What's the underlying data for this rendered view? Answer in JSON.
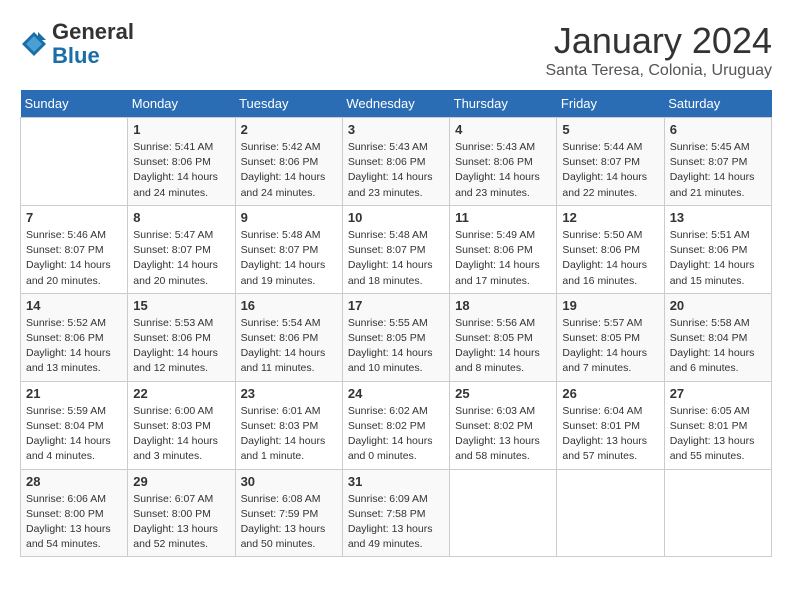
{
  "logo": {
    "general": "General",
    "blue": "Blue"
  },
  "header": {
    "month": "January 2024",
    "location": "Santa Teresa, Colonia, Uruguay"
  },
  "weekdays": [
    "Sunday",
    "Monday",
    "Tuesday",
    "Wednesday",
    "Thursday",
    "Friday",
    "Saturday"
  ],
  "weeks": [
    [
      {
        "day": "",
        "info": ""
      },
      {
        "day": "1",
        "info": "Sunrise: 5:41 AM\nSunset: 8:06 PM\nDaylight: 14 hours\nand 24 minutes."
      },
      {
        "day": "2",
        "info": "Sunrise: 5:42 AM\nSunset: 8:06 PM\nDaylight: 14 hours\nand 24 minutes."
      },
      {
        "day": "3",
        "info": "Sunrise: 5:43 AM\nSunset: 8:06 PM\nDaylight: 14 hours\nand 23 minutes."
      },
      {
        "day": "4",
        "info": "Sunrise: 5:43 AM\nSunset: 8:06 PM\nDaylight: 14 hours\nand 23 minutes."
      },
      {
        "day": "5",
        "info": "Sunrise: 5:44 AM\nSunset: 8:07 PM\nDaylight: 14 hours\nand 22 minutes."
      },
      {
        "day": "6",
        "info": "Sunrise: 5:45 AM\nSunset: 8:07 PM\nDaylight: 14 hours\nand 21 minutes."
      }
    ],
    [
      {
        "day": "7",
        "info": "Sunrise: 5:46 AM\nSunset: 8:07 PM\nDaylight: 14 hours\nand 20 minutes."
      },
      {
        "day": "8",
        "info": "Sunrise: 5:47 AM\nSunset: 8:07 PM\nDaylight: 14 hours\nand 20 minutes."
      },
      {
        "day": "9",
        "info": "Sunrise: 5:48 AM\nSunset: 8:07 PM\nDaylight: 14 hours\nand 19 minutes."
      },
      {
        "day": "10",
        "info": "Sunrise: 5:48 AM\nSunset: 8:07 PM\nDaylight: 14 hours\nand 18 minutes."
      },
      {
        "day": "11",
        "info": "Sunrise: 5:49 AM\nSunset: 8:06 PM\nDaylight: 14 hours\nand 17 minutes."
      },
      {
        "day": "12",
        "info": "Sunrise: 5:50 AM\nSunset: 8:06 PM\nDaylight: 14 hours\nand 16 minutes."
      },
      {
        "day": "13",
        "info": "Sunrise: 5:51 AM\nSunset: 8:06 PM\nDaylight: 14 hours\nand 15 minutes."
      }
    ],
    [
      {
        "day": "14",
        "info": "Sunrise: 5:52 AM\nSunset: 8:06 PM\nDaylight: 14 hours\nand 13 minutes."
      },
      {
        "day": "15",
        "info": "Sunrise: 5:53 AM\nSunset: 8:06 PM\nDaylight: 14 hours\nand 12 minutes."
      },
      {
        "day": "16",
        "info": "Sunrise: 5:54 AM\nSunset: 8:06 PM\nDaylight: 14 hours\nand 11 minutes."
      },
      {
        "day": "17",
        "info": "Sunrise: 5:55 AM\nSunset: 8:05 PM\nDaylight: 14 hours\nand 10 minutes."
      },
      {
        "day": "18",
        "info": "Sunrise: 5:56 AM\nSunset: 8:05 PM\nDaylight: 14 hours\nand 8 minutes."
      },
      {
        "day": "19",
        "info": "Sunrise: 5:57 AM\nSunset: 8:05 PM\nDaylight: 14 hours\nand 7 minutes."
      },
      {
        "day": "20",
        "info": "Sunrise: 5:58 AM\nSunset: 8:04 PM\nDaylight: 14 hours\nand 6 minutes."
      }
    ],
    [
      {
        "day": "21",
        "info": "Sunrise: 5:59 AM\nSunset: 8:04 PM\nDaylight: 14 hours\nand 4 minutes."
      },
      {
        "day": "22",
        "info": "Sunrise: 6:00 AM\nSunset: 8:03 PM\nDaylight: 14 hours\nand 3 minutes."
      },
      {
        "day": "23",
        "info": "Sunrise: 6:01 AM\nSunset: 8:03 PM\nDaylight: 14 hours\nand 1 minute."
      },
      {
        "day": "24",
        "info": "Sunrise: 6:02 AM\nSunset: 8:02 PM\nDaylight: 14 hours\nand 0 minutes."
      },
      {
        "day": "25",
        "info": "Sunrise: 6:03 AM\nSunset: 8:02 PM\nDaylight: 13 hours\nand 58 minutes."
      },
      {
        "day": "26",
        "info": "Sunrise: 6:04 AM\nSunset: 8:01 PM\nDaylight: 13 hours\nand 57 minutes."
      },
      {
        "day": "27",
        "info": "Sunrise: 6:05 AM\nSunset: 8:01 PM\nDaylight: 13 hours\nand 55 minutes."
      }
    ],
    [
      {
        "day": "28",
        "info": "Sunrise: 6:06 AM\nSunset: 8:00 PM\nDaylight: 13 hours\nand 54 minutes."
      },
      {
        "day": "29",
        "info": "Sunrise: 6:07 AM\nSunset: 8:00 PM\nDaylight: 13 hours\nand 52 minutes."
      },
      {
        "day": "30",
        "info": "Sunrise: 6:08 AM\nSunset: 7:59 PM\nDaylight: 13 hours\nand 50 minutes."
      },
      {
        "day": "31",
        "info": "Sunrise: 6:09 AM\nSunset: 7:58 PM\nDaylight: 13 hours\nand 49 minutes."
      },
      {
        "day": "",
        "info": ""
      },
      {
        "day": "",
        "info": ""
      },
      {
        "day": "",
        "info": ""
      }
    ]
  ]
}
